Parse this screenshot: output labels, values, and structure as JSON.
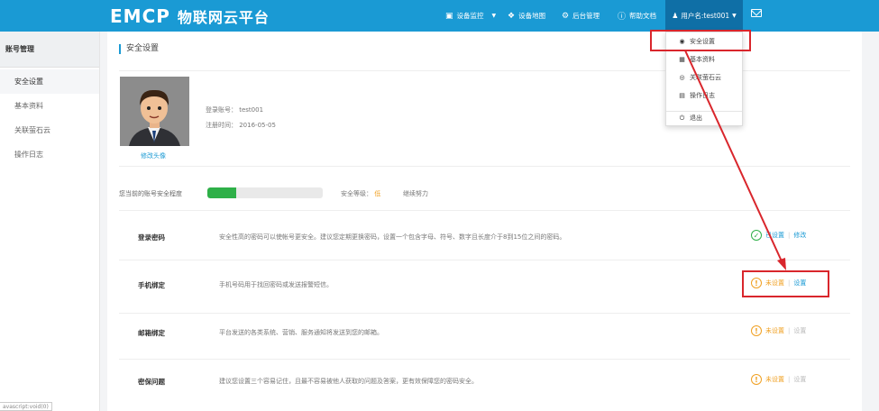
{
  "header": {
    "logo_mark": "EMCP",
    "logo_title": "物联网云平台",
    "nav": [
      {
        "icon": "monitor-icon",
        "label": "设备监控"
      },
      {
        "icon": "map-icon",
        "label": "设备地图"
      },
      {
        "icon": "gears-icon",
        "label": "后台管理"
      },
      {
        "icon": "help-icon",
        "label": "帮助文档"
      }
    ],
    "user_label": "用户名:test001",
    "mail_icon": "mail-icon"
  },
  "sidebar": {
    "title": "账号管理",
    "items": [
      {
        "label": "安全设置",
        "active": true
      },
      {
        "label": "基本资料",
        "active": false
      },
      {
        "label": "关联萤石云",
        "active": false
      },
      {
        "label": "操作日志",
        "active": false
      }
    ],
    "url_hint": "avascript:void(0)"
  },
  "main": {
    "title": "安全设置",
    "avatar_link": "修改头像",
    "account_label": "登录账号： test001",
    "register_label": "注册时间： 2016-05-05",
    "security": {
      "label": "您当前的账号安全程度",
      "progress": 0.25,
      "level_prefix": "安全等级：",
      "level": "低",
      "hint": "继续努力"
    },
    "rows": [
      {
        "name": "登录密码",
        "desc": "安全性高的密码可以使帐号更安全。建议您定期更换密码，设置一个包含字母、符号、数字且长度介于8到15位之间的密码。",
        "status": "已设置",
        "state": "set",
        "action": "修改",
        "action_enabled": true
      },
      {
        "name": "手机绑定",
        "desc": "手机号码用于找回密码或发送报警短信。",
        "status": "未设置",
        "state": "unset",
        "action": "设置",
        "action_enabled": true
      },
      {
        "name": "邮箱绑定",
        "desc": "平台发送的各类系统、营销、服务通知将发送到您的邮箱。",
        "status": "未设置",
        "state": "unset",
        "action": "设置",
        "action_enabled": false
      },
      {
        "name": "密保问题",
        "desc": "建议您设置三个容易记住，且最不容易被他人获取的问题及答案，更有效保障您的密码安全。",
        "status": "未设置",
        "state": "unset",
        "action": "设置",
        "action_enabled": false
      }
    ]
  },
  "dropdown": {
    "items": [
      {
        "icon": "settings-circle-icon",
        "label": "安全设置"
      },
      {
        "icon": "profile-card-icon",
        "label": "基本资料"
      },
      {
        "icon": "link-circle-icon",
        "label": "关联萤石云"
      },
      {
        "icon": "document-icon",
        "label": "操作日志"
      },
      {
        "icon": "power-icon",
        "label": "退出"
      }
    ]
  },
  "colors": {
    "header": "#1a9ad4",
    "header_active": "#0f6fa6",
    "success": "#2eb048",
    "warning": "#f0a022",
    "annotation": "#d9262c"
  }
}
